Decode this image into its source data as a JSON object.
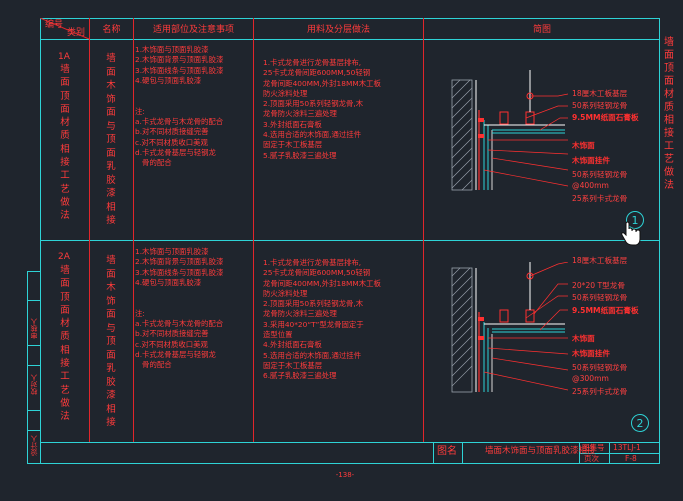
{
  "header": {
    "code": "编号",
    "category": "类别",
    "name": "名称",
    "scope": "适用部位及注意事项",
    "method": "用料及分层做法",
    "diagram": "简图"
  },
  "side_title": "墙面顶面材质相接工艺做法",
  "rows": [
    {
      "code": "1A",
      "title": "墙面顶面材质相接工艺做法",
      "name": "墙面木饰面与顶面乳胶漆相接",
      "scope": "1.木饰面与顶面乳胶漆\n2.木饰面背景与顶面乳胶漆\n3.木饰面线条与顶面乳胶漆\n4.硬包与顶面乳胶漆\n\n\n注:\na.卡式龙骨与木龙骨的配合\nb.对不同材质接缝完善\nc.对不同材质收口美观\nd.卡式龙骨基层与轻钢龙\n   骨的配合",
      "method": "1.卡式龙骨进行龙骨基层排布,\n25卡式龙骨间距600MM,50轻钢\n龙骨间距400MM,外封18MM木工板\n防火涂料处理\n2.顶面采用50系列轻钢龙骨,木\n龙骨防火涂料三遍处理\n3.外封纸面石膏板\n4.选用合适的木饰面,通过挂件\n固定于木工板基层\n5.腻子乳胶漆三遍处理",
      "labels": [
        "18厘木工板基层",
        "50系列轻钢龙骨",
        "9.5MM纸面石膏板",
        "木饰面",
        "木饰面挂件",
        "50系列轻钢龙骨",
        "@400mm",
        "25系列卡式龙骨"
      ],
      "circle": "1"
    },
    {
      "code": "2A",
      "title": "墙面顶面材质相接工艺做法",
      "name": "墙面木饰面与顶面乳胶漆相接",
      "scope": "1.木饰面与顶面乳胶漆\n2.木饰面背景与顶面乳胶漆\n3.木饰面线条与顶面乳胶漆\n4.硬包与顶面乳胶漆\n\n\n注:\na.卡式龙骨与木龙骨的配合\nb.对不同材质接缝完善\nc.对不同材质收口美观\nd.卡式龙骨基层与轻钢龙\n   骨的配合",
      "method": "1.卡式龙骨进行龙骨基层排布,\n25卡式龙骨间距600MM,50轻钢\n龙骨间距400MM,外封18MM木工板\n防火涂料处理\n2.顶面采用50系列轻钢龙骨,木\n龙骨防火涂料三遍处理\n3.采用40*20“T”型龙骨固定于\n造型位置\n4.外封纸面石膏板\n5.选用合适的木饰面,通过挂件\n固定于木工板基层\n6.腻子乳胶漆三遍处理",
      "labels": [
        "18厘木工板基层",
        "20*20 T型龙骨",
        "50系列轻钢龙骨",
        "9.5MM纸面石膏板",
        "木饰面",
        "木饰面挂件",
        "50系列轻钢龙骨",
        "@300mm",
        "25系列卡式龙骨"
      ],
      "circle": "2"
    }
  ],
  "title_block": {
    "figure_name_label": "图名",
    "figure_name": "墙面木饰面与顶面乳胶漆相接",
    "atlas_no_label": "图集号",
    "atlas_no": "13TLJ-1",
    "page_label": "页次",
    "page_no": "F-8"
  },
  "left_stamps": [
    "审核人",
    "校对人",
    "设计人"
  ],
  "page_number": "-138-",
  "colors": {
    "background": "#1f252d",
    "frame": "#2ed3d6",
    "text": "#ff3b3b",
    "hatch": "#9aa3ad",
    "accent": "#ff3030"
  }
}
